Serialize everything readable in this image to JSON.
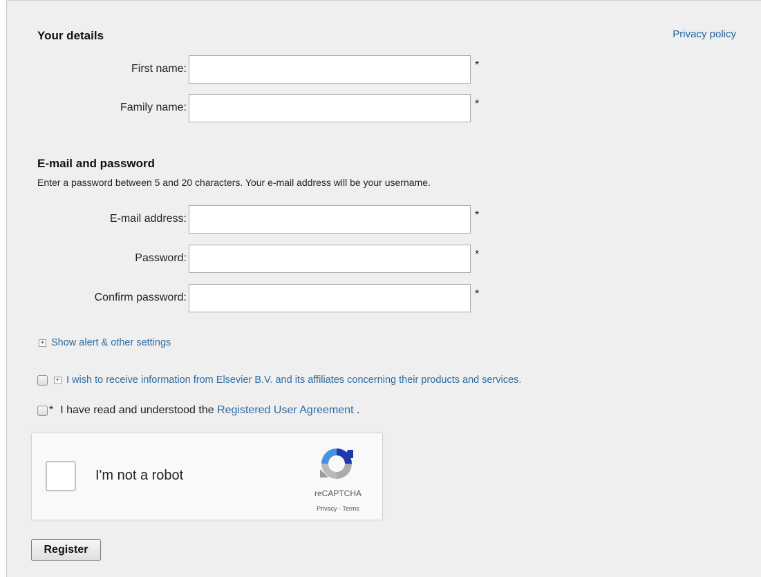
{
  "privacy_link": "Privacy policy",
  "details": {
    "title": "Your details",
    "first_name_label": "First name:",
    "family_name_label": "Family name:",
    "first_name_value": "",
    "family_name_value": "",
    "required_mark": "*"
  },
  "credentials": {
    "title": "E-mail and password",
    "description": "Enter a password between 5 and 20 characters. Your e-mail address will be your username.",
    "email_label": "E-mail address:",
    "password_label": "Password:",
    "confirm_label": "Confirm password:",
    "email_value": "",
    "password_value": "",
    "confirm_value": "",
    "required_mark": "*"
  },
  "alert_settings": {
    "expand_glyph": "+",
    "label": "Show alert & other settings"
  },
  "marketing": {
    "expand_glyph": "+",
    "label": "I wish to receive information from Elsevier B.V. and its affiliates concerning their products and services."
  },
  "agreement": {
    "required_mark": "*",
    "prefix": "I have read and understood the",
    "link": "Registered User Agreement",
    "suffix": "."
  },
  "captcha": {
    "label": "I'm not a robot",
    "brand": "reCAPTCHA",
    "terms": "Privacy - Terms",
    "icon": "recaptcha-logo-icon"
  },
  "register_button": "Register"
}
